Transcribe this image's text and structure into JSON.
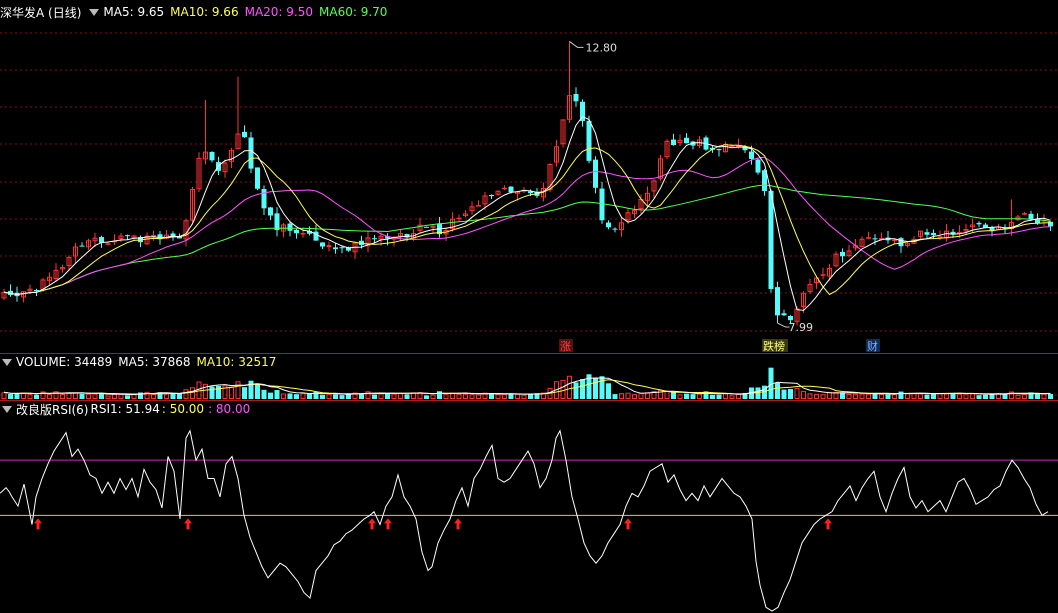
{
  "main": {
    "title": "深华发A (日线)",
    "ma5_label": "MA5: 9.65",
    "ma10_label": "MA10: 9.66",
    "ma20_label": "MA20: 9.50",
    "ma60_label": "MA60: 9.70",
    "high_label": "12.80",
    "low_label": "7.99",
    "markers": [
      "涨",
      "跌榜",
      "财"
    ]
  },
  "volume": {
    "label": "VOLUME: 34489",
    "ma5_label": "MA5: 37868",
    "ma10_label": "MA10: 32517"
  },
  "rsi": {
    "label": "改良版RSI(6)",
    "rsi1_label": "RSI1: 51.94",
    "line50_label": ": 50.00",
    "line80_label": ": 80.00"
  },
  "colors": {
    "up": "#ff3232",
    "down": "#54fcfc",
    "ma5": "#ffffff",
    "ma10": "#ffff54",
    "ma20": "#ff54ff",
    "ma60": "#54ff54",
    "grid": "#8a1010"
  },
  "chart_data": [
    {
      "type": "candlestick",
      "title": "深华发A (日线)",
      "ylim": [
        7.7,
        13.2
      ],
      "max_price": 12.8,
      "min_price": 7.99,
      "series": [
        {
          "name": "MA5",
          "value": 9.65
        },
        {
          "name": "MA10",
          "value": 9.66
        },
        {
          "name": "MA20",
          "value": 9.5
        },
        {
          "name": "MA60",
          "value": 9.7
        }
      ]
    },
    {
      "type": "bar",
      "title": "VOLUME",
      "series": [
        {
          "name": "VOLUME",
          "value": 34489
        },
        {
          "name": "MA5",
          "value": 37868
        },
        {
          "name": "MA10",
          "value": 32517
        }
      ]
    },
    {
      "type": "line",
      "title": "改良版RSI(6)",
      "ylim": [
        -2,
        104
      ],
      "reference_lines": [
        50,
        80
      ],
      "x": [
        0,
        6,
        9,
        12,
        18,
        24,
        28,
        32,
        36,
        42,
        48,
        54,
        60,
        66,
        72,
        78,
        84,
        90,
        96,
        102,
        108,
        114,
        120,
        126,
        132,
        138,
        144,
        150,
        156,
        162,
        168,
        174,
        180,
        186,
        190,
        196,
        202,
        208,
        214,
        220,
        226,
        232,
        238,
        244,
        250,
        256,
        262,
        268,
        274,
        280,
        286,
        292,
        298,
        304,
        310,
        316,
        322,
        328,
        334,
        340,
        346,
        352,
        358,
        364,
        370,
        374,
        380,
        386,
        392,
        398,
        404,
        410,
        416,
        422,
        428,
        432,
        438,
        444,
        450,
        456,
        462,
        468,
        474,
        480,
        486,
        492,
        498,
        504,
        510,
        516,
        522,
        528,
        534,
        540,
        546,
        552,
        556,
        560,
        566,
        572,
        578,
        584,
        590,
        596,
        602,
        608,
        614,
        620,
        626,
        632,
        638,
        644,
        650,
        656,
        662,
        668,
        674,
        680,
        686,
        692,
        698,
        704,
        710,
        716,
        722,
        728,
        734,
        740,
        746,
        752,
        756,
        760,
        766,
        772,
        778,
        784,
        790,
        796,
        802,
        808,
        814,
        820,
        826,
        832,
        838,
        844,
        850,
        856,
        862,
        868,
        874,
        880,
        886,
        892,
        898,
        904,
        910,
        916,
        922,
        928,
        934,
        940,
        946,
        952,
        958,
        964,
        970,
        976,
        982,
        988,
        994,
        1000,
        1006,
        1012,
        1018,
        1024,
        1030,
        1036,
        1042,
        1048,
        1052
      ],
      "values": [
        62,
        65,
        63,
        60,
        55,
        67,
        56,
        45,
        60,
        70,
        78,
        85,
        90,
        95,
        82,
        86,
        80,
        72,
        70,
        62,
        68,
        62,
        70,
        64,
        70,
        60,
        75,
        68,
        64,
        54,
        82,
        74,
        48,
        92,
        96,
        80,
        86,
        70,
        70,
        60,
        78,
        82,
        70,
        50,
        38,
        30,
        22,
        16,
        20,
        24,
        22,
        18,
        14,
        8,
        5,
        20,
        24,
        28,
        34,
        36,
        40,
        42,
        45,
        48,
        50,
        52,
        45,
        55,
        60,
        72,
        60,
        55,
        48,
        30,
        20,
        22,
        35,
        42,
        48,
        58,
        65,
        55,
        70,
        75,
        82,
        88,
        70,
        68,
        70,
        75,
        80,
        85,
        78,
        65,
        70,
        80,
        92,
        96,
        80,
        60,
        48,
        35,
        28,
        24,
        28,
        35,
        40,
        45,
        55,
        62,
        60,
        66,
        74,
        76,
        78,
        68,
        72,
        64,
        58,
        62,
        58,
        66,
        60,
        65,
        70,
        66,
        62,
        60,
        55,
        48,
        25,
        12,
        0,
        -2,
        0,
        8,
        15,
        25,
        35,
        40,
        45,
        48,
        50,
        52,
        58,
        62,
        66,
        58,
        65,
        70,
        74,
        60,
        52,
        62,
        70,
        76,
        60,
        54,
        58,
        52,
        55,
        58,
        52,
        60,
        68,
        70,
        64,
        56,
        58,
        60,
        64,
        66,
        74,
        80,
        76,
        70,
        65,
        56,
        50,
        52
      ]
    }
  ]
}
